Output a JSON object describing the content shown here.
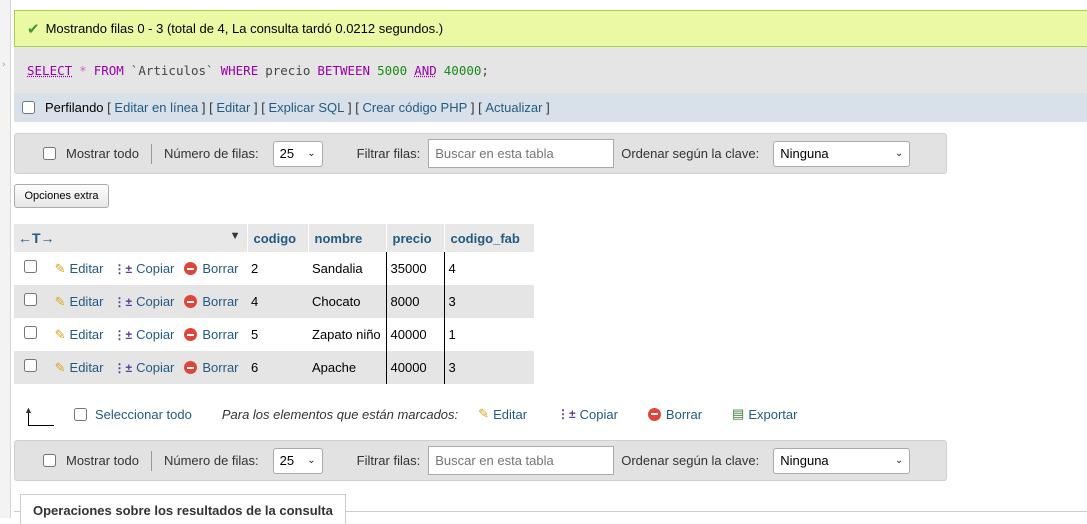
{
  "success_message": "Mostrando filas 0 - 3 (total de 4, La consulta tardó 0.0212 segundos.)",
  "sql": {
    "select": "SELECT",
    "star": "*",
    "from": "FROM",
    "table": "`Articulos`",
    "where": "WHERE",
    "column": "precio",
    "between": "BETWEEN",
    "low": "5000",
    "and": "AND",
    "high": "40000",
    "end": ";"
  },
  "profiling": {
    "label": "Perfilando",
    "links": [
      "Editar en línea",
      "Editar",
      "Explicar SQL",
      "Crear código PHP",
      "Actualizar"
    ]
  },
  "nav": {
    "show_all": "Mostrar todo",
    "rows_label": "Número de filas:",
    "rows_value": "25",
    "filter_label": "Filtrar filas:",
    "filter_placeholder": "Buscar en esta tabla",
    "sort_label": "Ordenar según la clave:",
    "sort_value": "Ninguna"
  },
  "extra_options": "Opciones extra",
  "table": {
    "columns": [
      "codigo",
      "nombre",
      "precio",
      "codigo_fab"
    ],
    "action_labels": {
      "edit": "Editar",
      "copy": "Copiar",
      "delete": "Borrar"
    },
    "rows": [
      {
        "codigo": "2",
        "nombre": "Sandalia",
        "precio": "35000",
        "codigo_fab": "4"
      },
      {
        "codigo": "4",
        "nombre": "Chocato",
        "precio": "8000",
        "codigo_fab": "3"
      },
      {
        "codigo": "5",
        "nombre": "Zapato niño",
        "precio": "40000",
        "codigo_fab": "1"
      },
      {
        "codigo": "6",
        "nombre": "Apache",
        "precio": "40000",
        "codigo_fab": "3"
      }
    ]
  },
  "bulk": {
    "select_all": "Seleccionar todo",
    "marked_label": "Para los elementos que están marcados:",
    "edit": "Editar",
    "copy": "Copiar",
    "delete": "Borrar",
    "export": "Exportar"
  },
  "operations_title": "Operaciones sobre los resultados de la consulta"
}
